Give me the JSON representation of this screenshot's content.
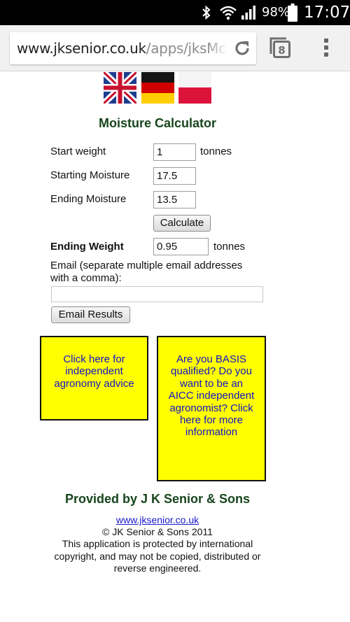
{
  "status_bar": {
    "battery": "98%",
    "time": "17:07",
    "icons": [
      "bluetooth-icon",
      "wifi-icon",
      "signal-icon",
      "battery-icon"
    ]
  },
  "browser": {
    "url_host": "www.jksenior.co.uk",
    "url_path": "/apps/jksMc",
    "tab_count": "8",
    "icons": [
      "reload-icon",
      "tabs-icon",
      "menu-icon"
    ]
  },
  "flags": [
    "uk-flag",
    "german-flag",
    "polish-flag"
  ],
  "calculator": {
    "title": "Moisture Calculator",
    "start_weight_label": "Start weight",
    "start_weight_value": "1",
    "start_weight_unit": "tonnes",
    "starting_moisture_label": "Starting Moisture",
    "starting_moisture_value": "17.5",
    "ending_moisture_label": "Ending Moisture",
    "ending_moisture_value": "13.5",
    "calculate_label": "Calculate",
    "ending_weight_label": "Ending Weight",
    "ending_weight_value": "0.95",
    "ending_weight_unit": "tonnes",
    "email_label": "Email (separate multiple email addresses with a comma):",
    "email_value": "",
    "email_button": "Email Results"
  },
  "promos": {
    "agronomy": "Click here for independent agronomy advice",
    "basis": "Are you BASIS qualified? Do you want to be an AICC independent agronomist? Click here for more information"
  },
  "footer": {
    "provided_by": "Provided by J K Senior & Sons",
    "link": "www.jksenior.co.uk",
    "copyright": "© JK Senior & Sons 2011",
    "disclaimer": "This application is protected by international copyright, and may not be copied, distributed or reverse engineered."
  },
  "colors": {
    "heading_green": "#17451d",
    "promo_yellow": "#ffff00",
    "link_blue": "#1a1acc"
  }
}
